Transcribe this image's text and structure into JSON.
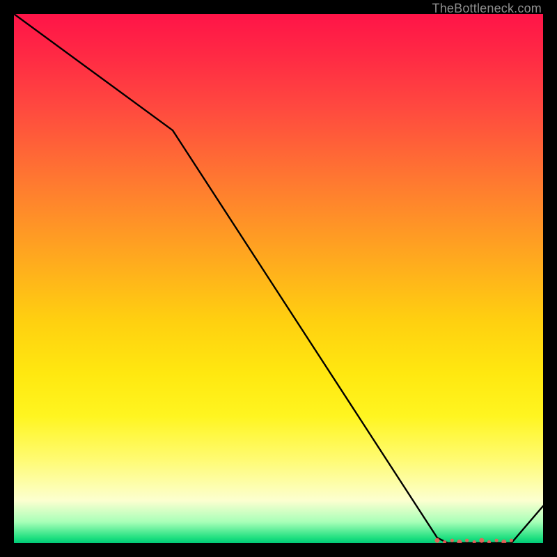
{
  "watermark": "TheBottleneck.com",
  "chart_data": {
    "type": "line",
    "title": "",
    "xlabel": "",
    "ylabel": "",
    "xlim": [
      0,
      100
    ],
    "ylim": [
      0,
      100
    ],
    "x": [
      0,
      30,
      80,
      82,
      84,
      86,
      88,
      90,
      92,
      94,
      100
    ],
    "values": [
      100,
      78,
      1,
      0,
      0,
      0,
      0,
      0,
      0,
      0,
      7
    ],
    "marker_range_x": [
      80,
      94
    ],
    "curve_color": "#000000",
    "marker_color": "#ff5555"
  }
}
